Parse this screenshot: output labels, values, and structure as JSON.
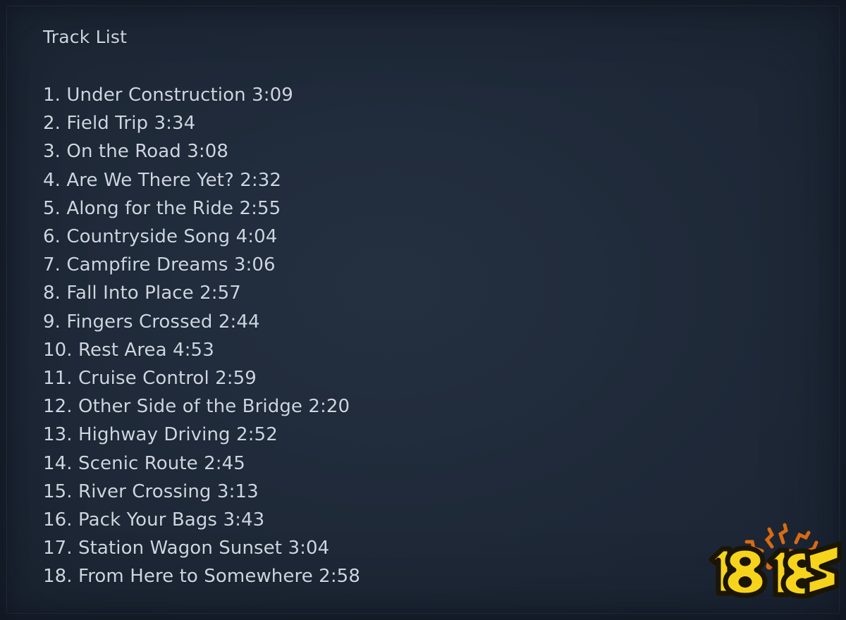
{
  "page": {
    "title": "Track List",
    "background_color": "#1e2837",
    "text_color": "#ccd5e0"
  },
  "tracks": [
    {
      "num": "1.",
      "title": "Under Construction",
      "time": "3:09"
    },
    {
      "num": "2.",
      "title": "Field Trip",
      "time": "3:34"
    },
    {
      "num": "3.",
      "title": "On the Road",
      "time": "3:08"
    },
    {
      "num": "4.",
      "title": "Are We There Yet?",
      "time": "2:32"
    },
    {
      "num": "5.",
      "title": "Along for the Ride",
      "time": "2:55"
    },
    {
      "num": "6.",
      "title": "Countryside Song",
      "time": "4:04"
    },
    {
      "num": "7.",
      "title": "Campfire Dreams",
      "time": "3:06"
    },
    {
      "num": "8.",
      "title": "Fall Into Place",
      "time": "2:57"
    },
    {
      "num": "9.",
      "title": "Fingers Crossed",
      "time": "2:44"
    },
    {
      "num": "10.",
      "title": "Rest Area",
      "time": "4:53"
    },
    {
      "num": "11.",
      "title": "Cruise Control",
      "time": "2:59"
    },
    {
      "num": "12.",
      "title": "Other Side of the Bridge",
      "time": "2:20"
    },
    {
      "num": "13.",
      "title": "Highway Driving",
      "time": "2:52"
    },
    {
      "num": "14.",
      "title": "Scenic Route",
      "time": "2:45"
    },
    {
      "num": "15.",
      "title": "River Crossing",
      "time": "3:13"
    },
    {
      "num": "16.",
      "title": "Pack Your Bags",
      "time": "3:43"
    },
    {
      "num": "17.",
      "title": "Station Wagon Sunset",
      "time": "3:04"
    },
    {
      "num": "18.",
      "title": "From Here to Somewhere",
      "time": "2:58"
    }
  ],
  "watermark": {
    "text": "18183",
    "icon": "sun-burst-icon",
    "logo_yellow": "#F7D41C",
    "logo_outline": "#1b1505",
    "sun_orange": "#D96B13",
    "sun_orange_light": "#E8921E"
  }
}
